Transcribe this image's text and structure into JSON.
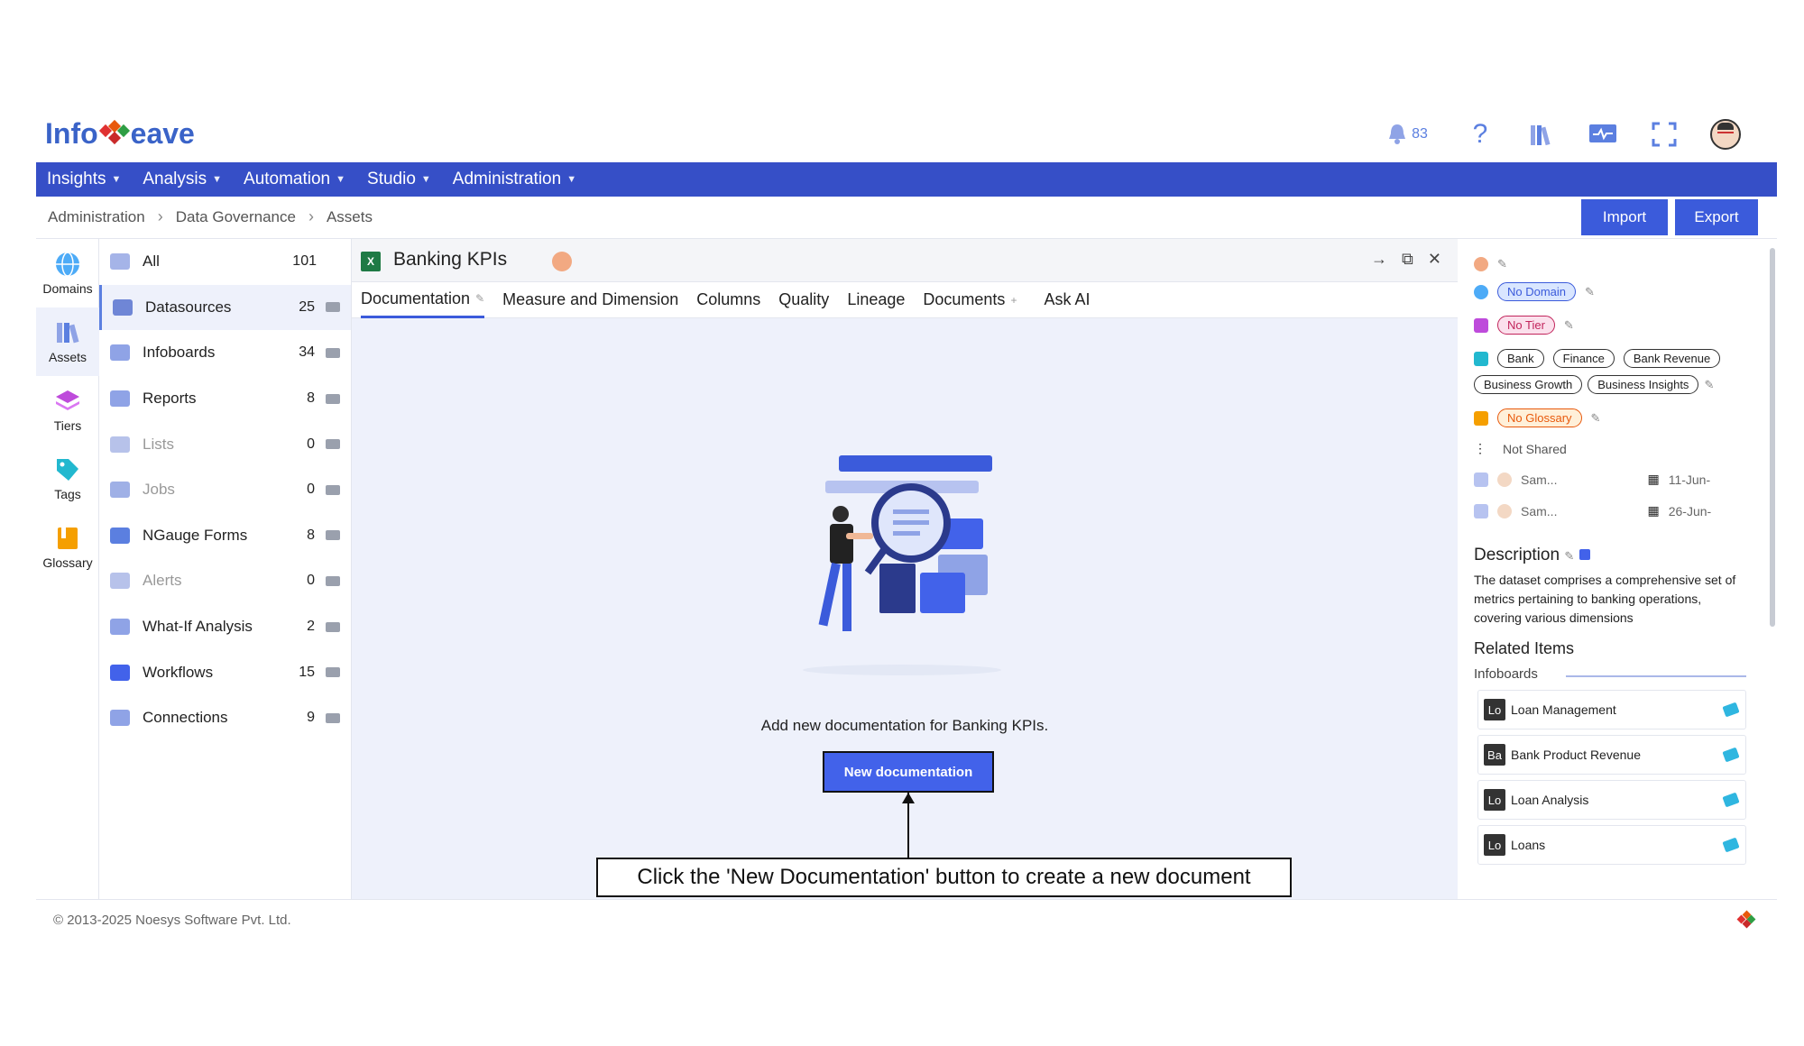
{
  "header": {
    "logo_left": "Info",
    "logo_right": "eave",
    "notifications_count": "83",
    "icons": [
      "bell-icon",
      "help-icon",
      "library-icon",
      "monitor-icon",
      "fullscreen-icon",
      "user-avatar"
    ]
  },
  "nav": [
    {
      "label": "Insights"
    },
    {
      "label": "Analysis"
    },
    {
      "label": "Automation"
    },
    {
      "label": "Studio"
    },
    {
      "label": "Administration"
    }
  ],
  "breadcrumb": [
    "Administration",
    "Data Governance",
    "Assets"
  ],
  "actions": {
    "import": "Import",
    "export": "Export"
  },
  "rail": [
    {
      "label": "Domains",
      "icon": "globe-icon"
    },
    {
      "label": "Assets",
      "icon": "books-icon"
    },
    {
      "label": "Tiers",
      "icon": "layers-icon"
    },
    {
      "label": "Tags",
      "icon": "tag-icon"
    },
    {
      "label": "Glossary",
      "icon": "book-icon"
    }
  ],
  "categories": [
    {
      "label": "All",
      "count": "101"
    },
    {
      "label": "Datasources",
      "count": "25"
    },
    {
      "label": "Infoboards",
      "count": "34"
    },
    {
      "label": "Reports",
      "count": "8"
    },
    {
      "label": "Lists",
      "count": "0"
    },
    {
      "label": "Jobs",
      "count": "0"
    },
    {
      "label": "NGauge Forms",
      "count": "8"
    },
    {
      "label": "Alerts",
      "count": "0"
    },
    {
      "label": "What-If Analysis",
      "count": "2"
    },
    {
      "label": "Workflows",
      "count": "15"
    },
    {
      "label": "Connections",
      "count": "9"
    }
  ],
  "asset": {
    "title": "Banking KPIs",
    "file_badge": "X"
  },
  "tabs": [
    {
      "label": "Documentation"
    },
    {
      "label": "Measure and Dimension"
    },
    {
      "label": "Columns"
    },
    {
      "label": "Quality"
    },
    {
      "label": "Lineage"
    },
    {
      "label": "Documents"
    },
    {
      "label": "Ask AI"
    }
  ],
  "empty_state": {
    "message": "Add new documentation for Banking KPIs.",
    "button": "New documentation"
  },
  "callout": "Click the 'New Documentation' button to create a new document",
  "details": {
    "domain": "No Domain",
    "tier": "No Tier",
    "tags": [
      "Bank",
      "Finance",
      "Bank Revenue",
      "Business Growth",
      "Business Insights"
    ],
    "glossary": "No Glossary",
    "shared": "Not Shared",
    "created_by": "Sam...",
    "created_on": "11-Jun-",
    "modified_by": "Sam...",
    "modified_on": "26-Jun-",
    "description_title": "Description",
    "description": "The dataset comprises a comprehensive set of metrics pertaining to banking operations, covering various dimensions",
    "related_title": "Related Items",
    "related_sub": "Infoboards",
    "related": [
      {
        "abbr": "Lo",
        "label": "Loan Management"
      },
      {
        "abbr": "Ba",
        "label": "Bank Product Revenue"
      },
      {
        "abbr": "Lo",
        "label": "Loan Analysis"
      },
      {
        "abbr": "Lo",
        "label": "Loans"
      }
    ]
  },
  "footer": {
    "copyright": "© 2013-2025 Noesys Software Pvt. Ltd."
  },
  "colors": {
    "brand": "#364fc7",
    "accent": "#4262ea",
    "panel_bg": "#eef1fb"
  }
}
